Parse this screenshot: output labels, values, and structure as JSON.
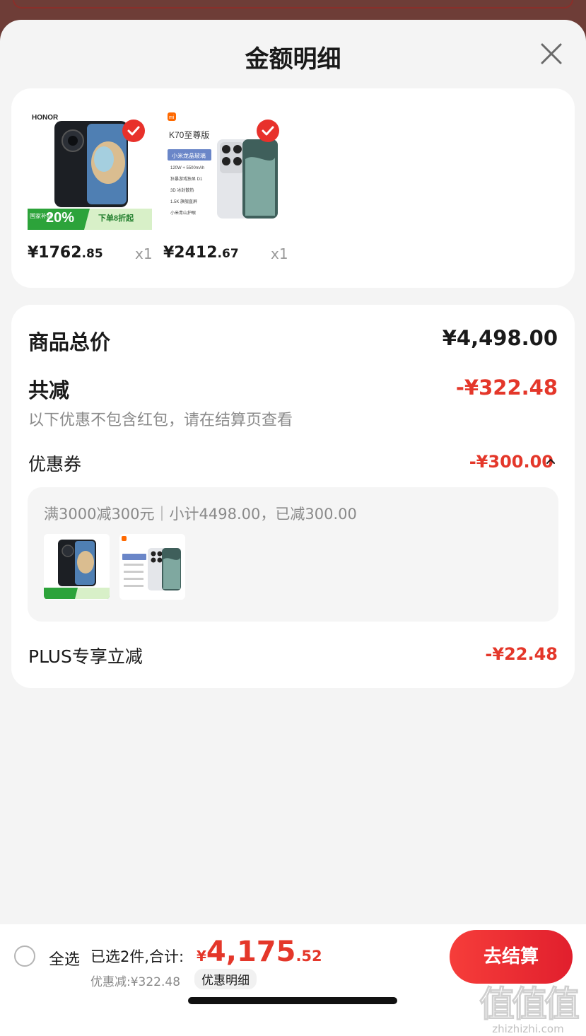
{
  "sheet": {
    "title": "金额明细"
  },
  "products": [
    {
      "brand": "HONOR",
      "banner_left": "国家补贴",
      "banner_pct": "20%",
      "banner_right": "下单8折起",
      "price_main": "¥1762",
      "price_cents": ".85",
      "qty": "x1"
    },
    {
      "brand": "mi",
      "model": "K70至尊版",
      "spec_title": "小米龙晶玻璃",
      "spec_lines": [
        "120W + 5500mAh",
        "狂暴游戏独显 D1",
        "3D 冰封散热",
        "1.5K 旗舰直屏",
        "小米青山护眼"
      ],
      "price_main": "¥2412",
      "price_cents": ".67",
      "qty": "x1"
    }
  ],
  "summary": {
    "total_label": "商品总价",
    "total_value": "¥4,498.00",
    "reduce_label": "共减",
    "reduce_value": "-¥322.48",
    "note": "以下优惠不包含红包，请在结算页查看",
    "coupon_label": "优惠券",
    "coupon_value": "-¥300.00",
    "coupon_desc": "满3000减300元｜小计4498.00，已减300.00",
    "plus_label": "PLUS专享立减",
    "plus_value": "-¥22.48"
  },
  "footer": {
    "select_all": "全选",
    "selected_prefix": "已选2件,合计:",
    "total_yen": "¥",
    "total_main": "4,175",
    "total_cents": ".52",
    "discount": "优惠减:¥322.48",
    "detail_link": "优惠明细",
    "checkout": "去结算"
  },
  "watermark": {
    "logo": "值值值",
    "url": "zhizhizhi.com"
  },
  "colors": {
    "accent_red": "#e4372a",
    "checkout_gradient_start": "#f63d3a",
    "checkout_gradient_end": "#e11f2d",
    "sheet_bg": "#f4f4f4"
  },
  "icons": [
    "close-icon",
    "check-icon",
    "chevron-up-icon",
    "radio-icon"
  ]
}
